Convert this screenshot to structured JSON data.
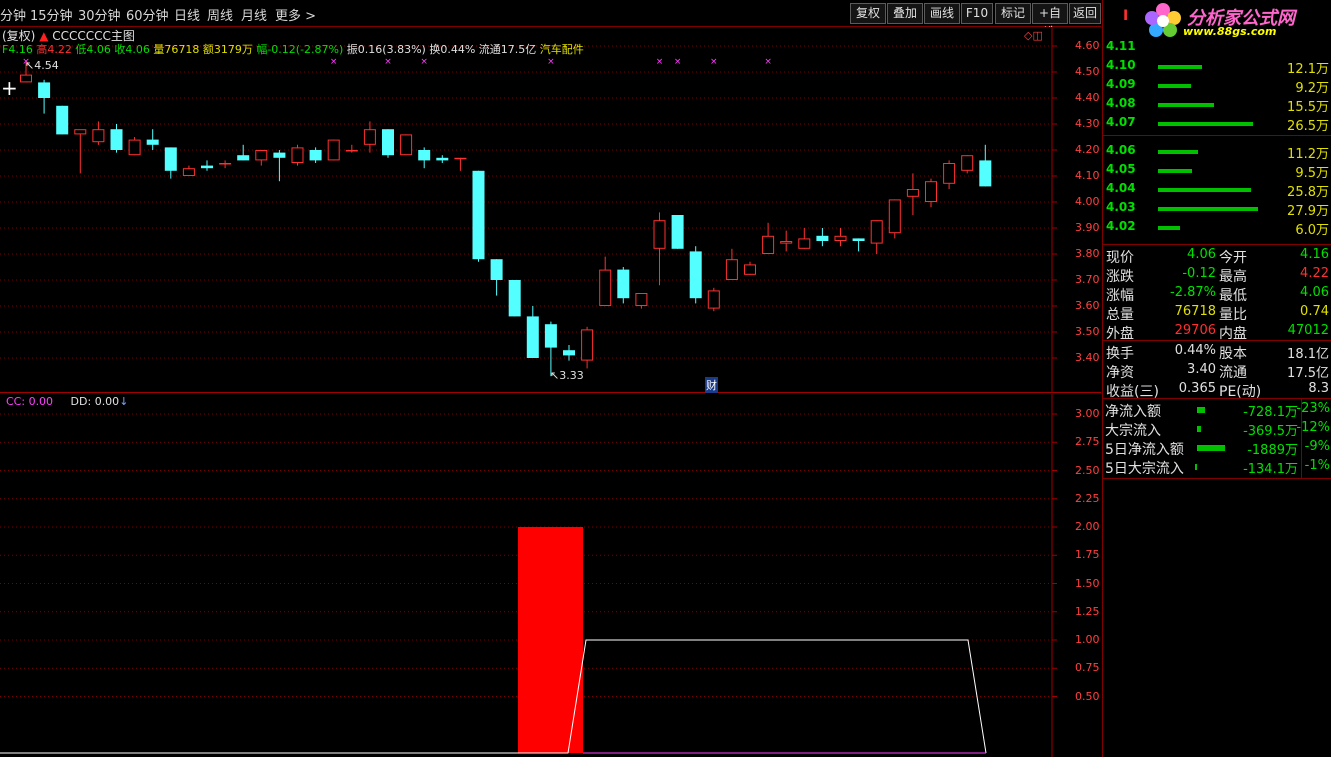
{
  "toolbar": {
    "periods": [
      "分钟",
      "15分钟",
      "30分钟",
      "60分钟",
      "日线",
      "周线",
      "月线",
      "更多 >"
    ],
    "buttons": [
      "复权",
      "叠加",
      "画线",
      "F10",
      "标记",
      "+自选",
      "返回"
    ]
  },
  "header": {
    "fuquan": "(复权)",
    "indicator_name": "CCCCCCC主图",
    "line2_prefix": "F4.16",
    "high_label": "高4.22",
    "low_label": "低4.06",
    "close_label": "收4.06",
    "vol_label": "量76718",
    "amount_label": "额3179万",
    "change_label": "幅-0.12(-2.87%)",
    "amp_label": "振0.16(3.83%)",
    "turnover_label": "换0.44%",
    "float_label": "流通17.5亿",
    "sector_label": "汽车配件",
    "sub_cc": "CC: 0.00",
    "sub_dd": "DD: 0.00",
    "cai_marker": "财",
    "high_marker": "4.54",
    "low_marker": "3.33",
    "plus_marker": "+"
  },
  "logo": {
    "title": "分析家公式网",
    "url": "www.88gs.com",
    "corner_letter": "I"
  },
  "main_axis": [
    "4.60",
    "4.50",
    "4.40",
    "4.30",
    "4.20",
    "4.10",
    "4.00",
    "3.90",
    "3.80",
    "3.70",
    "3.60",
    "3.50",
    "3.40"
  ],
  "sub_axis": [
    "3.00",
    "2.75",
    "2.50",
    "2.25",
    "2.00",
    "1.75",
    "1.50",
    "1.25",
    "1.00",
    "0.75",
    "0.50"
  ],
  "chart_data": {
    "type": "candlestick",
    "price_range": [
      3.33,
      4.62
    ],
    "candles": [
      {
        "o": 4.46,
        "h": 4.54,
        "l": 4.46,
        "c": 4.49
      },
      {
        "o": 4.46,
        "h": 4.47,
        "l": 4.34,
        "c": 4.4
      },
      {
        "o": 4.37,
        "h": 4.37,
        "l": 4.26,
        "c": 4.26
      },
      {
        "o": 4.26,
        "h": 4.27,
        "l": 4.11,
        "c": 4.28
      },
      {
        "o": 4.23,
        "h": 4.31,
        "l": 4.22,
        "c": 4.28
      },
      {
        "o": 4.28,
        "h": 4.3,
        "l": 4.19,
        "c": 4.2
      },
      {
        "o": 4.18,
        "h": 4.25,
        "l": 4.18,
        "c": 4.24
      },
      {
        "o": 4.24,
        "h": 4.28,
        "l": 4.2,
        "c": 4.22
      },
      {
        "o": 4.21,
        "h": 4.21,
        "l": 4.09,
        "c": 4.12
      },
      {
        "o": 4.1,
        "h": 4.14,
        "l": 4.1,
        "c": 4.13
      },
      {
        "o": 4.14,
        "h": 4.16,
        "l": 4.12,
        "c": 4.13
      },
      {
        "o": 4.15,
        "h": 4.16,
        "l": 4.13,
        "c": 4.15
      },
      {
        "o": 4.18,
        "h": 4.22,
        "l": 4.16,
        "c": 4.16
      },
      {
        "o": 4.16,
        "h": 4.2,
        "l": 4.14,
        "c": 4.2
      },
      {
        "o": 4.19,
        "h": 4.2,
        "l": 4.08,
        "c": 4.17
      },
      {
        "o": 4.15,
        "h": 4.22,
        "l": 4.14,
        "c": 4.21
      },
      {
        "o": 4.2,
        "h": 4.21,
        "l": 4.15,
        "c": 4.16
      },
      {
        "o": 4.16,
        "h": 4.24,
        "l": 4.16,
        "c": 4.24
      },
      {
        "o": 4.2,
        "h": 4.22,
        "l": 4.19,
        "c": 4.2
      },
      {
        "o": 4.22,
        "h": 4.31,
        "l": 4.19,
        "c": 4.28
      },
      {
        "o": 4.28,
        "h": 4.28,
        "l": 4.17,
        "c": 4.18
      },
      {
        "o": 4.18,
        "h": 4.26,
        "l": 4.18,
        "c": 4.26
      },
      {
        "o": 4.2,
        "h": 4.21,
        "l": 4.13,
        "c": 4.16
      },
      {
        "o": 4.17,
        "h": 4.18,
        "l": 4.15,
        "c": 4.16
      },
      {
        "o": 4.17,
        "h": 4.17,
        "l": 4.12,
        "c": 4.17
      },
      {
        "o": 4.12,
        "h": 4.12,
        "l": 3.77,
        "c": 3.78
      },
      {
        "o": 3.78,
        "h": 3.78,
        "l": 3.64,
        "c": 3.7
      },
      {
        "o": 3.7,
        "h": 3.7,
        "l": 3.56,
        "c": 3.56
      },
      {
        "o": 3.56,
        "h": 3.6,
        "l": 3.4,
        "c": 3.4
      },
      {
        "o": 3.53,
        "h": 3.54,
        "l": 3.33,
        "c": 3.44
      },
      {
        "o": 3.43,
        "h": 3.45,
        "l": 3.39,
        "c": 3.41
      },
      {
        "o": 3.39,
        "h": 3.52,
        "l": 3.36,
        "c": 3.51
      },
      {
        "o": 3.6,
        "h": 3.79,
        "l": 3.6,
        "c": 3.74
      },
      {
        "o": 3.74,
        "h": 3.75,
        "l": 3.61,
        "c": 3.63
      },
      {
        "o": 3.6,
        "h": 3.65,
        "l": 3.59,
        "c": 3.65
      },
      {
        "o": 3.82,
        "h": 3.96,
        "l": 3.68,
        "c": 3.93
      },
      {
        "o": 3.95,
        "h": 3.95,
        "l": 3.82,
        "c": 3.82
      },
      {
        "o": 3.81,
        "h": 3.83,
        "l": 3.61,
        "c": 3.63
      },
      {
        "o": 3.59,
        "h": 3.67,
        "l": 3.58,
        "c": 3.66
      },
      {
        "o": 3.7,
        "h": 3.82,
        "l": 3.7,
        "c": 3.78
      },
      {
        "o": 3.72,
        "h": 3.77,
        "l": 3.72,
        "c": 3.76
      },
      {
        "o": 3.8,
        "h": 3.92,
        "l": 3.8,
        "c": 3.87
      },
      {
        "o": 3.84,
        "h": 3.89,
        "l": 3.81,
        "c": 3.85
      },
      {
        "o": 3.82,
        "h": 3.9,
        "l": 3.82,
        "c": 3.86
      },
      {
        "o": 3.87,
        "h": 3.9,
        "l": 3.83,
        "c": 3.85
      },
      {
        "o": 3.85,
        "h": 3.9,
        "l": 3.83,
        "c": 3.87
      },
      {
        "o": 3.86,
        "h": 3.86,
        "l": 3.81,
        "c": 3.85
      },
      {
        "o": 3.84,
        "h": 3.93,
        "l": 3.8,
        "c": 3.93
      },
      {
        "o": 3.88,
        "h": 4.01,
        "l": 3.86,
        "c": 4.01
      },
      {
        "o": 4.02,
        "h": 4.11,
        "l": 3.95,
        "c": 4.05
      },
      {
        "o": 4.0,
        "h": 4.09,
        "l": 3.98,
        "c": 4.08
      },
      {
        "o": 4.07,
        "h": 4.16,
        "l": 4.05,
        "c": 4.15
      },
      {
        "o": 4.12,
        "h": 4.18,
        "l": 4.11,
        "c": 4.18
      },
      {
        "o": 4.16,
        "h": 4.22,
        "l": 4.06,
        "c": 4.06
      }
    ],
    "sub_series": {
      "red_bar": {
        "from": 29,
        "to": 32,
        "value": 2.0
      },
      "white_line": [
        0,
        0,
        0,
        0,
        0,
        0,
        0,
        0,
        0,
        0,
        0,
        0,
        0,
        0,
        0,
        0,
        0,
        0,
        0,
        0,
        0,
        0,
        0,
        0,
        0,
        0,
        0,
        0,
        0,
        0,
        0,
        1,
        1,
        1,
        1,
        1,
        1,
        1,
        1,
        1,
        1,
        1,
        1,
        1,
        1,
        1,
        1,
        1,
        1,
        1,
        1,
        1,
        1,
        1,
        0
      ]
    },
    "sub_range": [
      0,
      3.0
    ]
  },
  "order_book": {
    "sell": [
      {
        "price": "4.11",
        "vol": "",
        "bar": 0
      },
      {
        "price": "4.10",
        "vol": "12.1万",
        "bar": 12.1
      },
      {
        "price": "4.09",
        "vol": "9.2万",
        "bar": 9.2
      },
      {
        "price": "4.08",
        "vol": "15.5万",
        "bar": 15.5
      },
      {
        "price": "4.07",
        "vol": "26.5万",
        "bar": 26.5
      }
    ],
    "buy": [
      {
        "price": "4.06",
        "vol": "11.2万",
        "bar": 11.2
      },
      {
        "price": "4.05",
        "vol": "9.5万",
        "bar": 9.5
      },
      {
        "price": "4.04",
        "vol": "25.8万",
        "bar": 25.8
      },
      {
        "price": "4.03",
        "vol": "27.9万",
        "bar": 27.9
      },
      {
        "price": "4.02",
        "vol": "6.0万",
        "bar": 6.0
      }
    ]
  },
  "quote": [
    {
      "k1": "现价",
      "v1": "4.06",
      "c1": "#00e000",
      "k2": "今开",
      "v2": "4.16",
      "c2": "#00e000"
    },
    {
      "k1": "涨跌",
      "v1": "-0.12",
      "c1": "#00e000",
      "k2": "最高",
      "v2": "4.22",
      "c2": "#ff3030"
    },
    {
      "k1": "涨幅",
      "v1": "-2.87%",
      "c1": "#00e000",
      "k2": "最低",
      "v2": "4.06",
      "c2": "#00e000"
    },
    {
      "k1": "总量",
      "v1": "76718",
      "c1": "#e0e000",
      "k2": "量比",
      "v2": "0.74",
      "c2": "#e0e000"
    },
    {
      "k1": "外盘",
      "v1": "29706",
      "c1": "#ff3030",
      "k2": "内盘",
      "v2": "47012",
      "c2": "#00e000"
    }
  ],
  "fundamentals": [
    {
      "k1": "换手",
      "v1": "0.44%",
      "k2": "股本",
      "v2": "18.1亿"
    },
    {
      "k1": "净资",
      "v1": "3.40",
      "k2": "流通",
      "v2": "17.5亿"
    },
    {
      "k1": "收益(三)",
      "v1": "0.365",
      "k2": "PE(动)",
      "v2": "8.3"
    }
  ],
  "flows": [
    {
      "label": "净流入额",
      "bar": 8,
      "value": "-728.1万",
      "pct": "-23%"
    },
    {
      "label": "大宗流入",
      "bar": 4,
      "value": "-369.5万",
      "pct": "-12%"
    },
    {
      "label": "5日净流入额",
      "bar": 28,
      "value": "-1889万",
      "pct": "-9%"
    },
    {
      "label": "5日大宗流入",
      "bar": 2,
      "value": "-134.1万",
      "pct": "-1%"
    }
  ],
  "colors": {
    "up": "#ff3030",
    "down": "#54ffff",
    "frame": "#800000",
    "grid": "#7a0000",
    "magenta": "#ff40ff"
  }
}
